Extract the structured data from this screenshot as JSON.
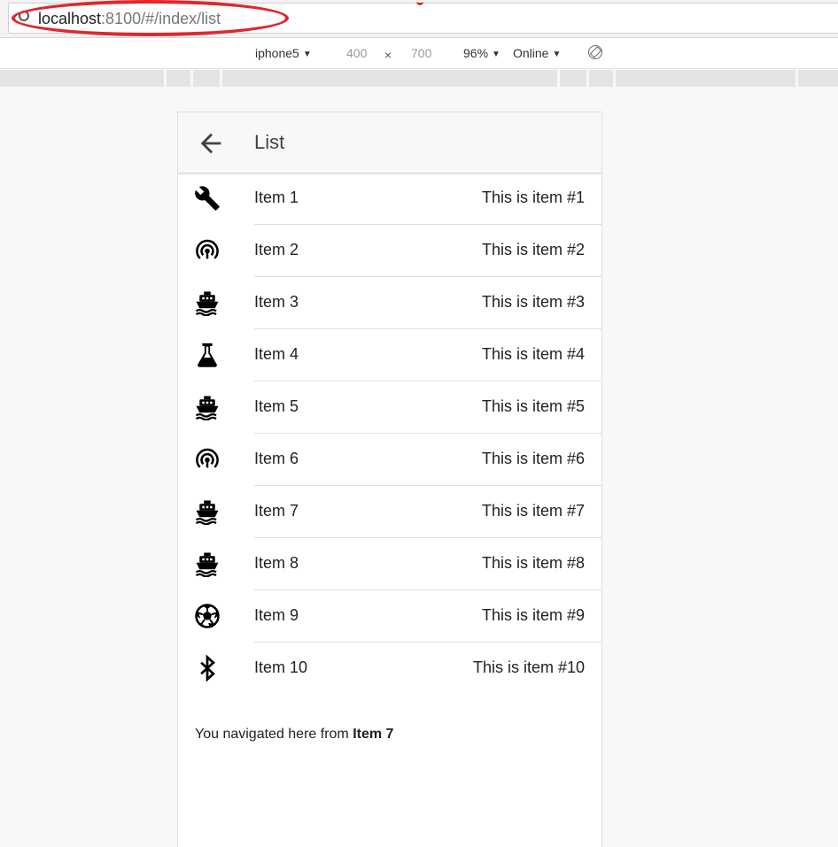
{
  "browser": {
    "url_host": "localhost",
    "url_rest": ":8100/#/index/list"
  },
  "device_toolbar": {
    "device": "iphone5",
    "width": "400",
    "times": "×",
    "height": "700",
    "zoom": "96%",
    "network": "Online",
    "dropdown_caret": "▼"
  },
  "app": {
    "title": "List",
    "back_icon": "arrow-back-icon",
    "items": [
      {
        "label": "Item 1",
        "note": "This is item #1",
        "icon": "wrench-icon"
      },
      {
        "label": "Item 2",
        "note": "This is item #2",
        "icon": "wifi-broadcast-icon"
      },
      {
        "label": "Item 3",
        "note": "This is item #3",
        "icon": "ship-icon"
      },
      {
        "label": "Item 4",
        "note": "This is item #4",
        "icon": "flask-icon"
      },
      {
        "label": "Item 5",
        "note": "This is item #5",
        "icon": "ship-icon"
      },
      {
        "label": "Item 6",
        "note": "This is item #6",
        "icon": "wifi-broadcast-icon"
      },
      {
        "label": "Item 7",
        "note": "This is item #7",
        "icon": "ship-icon"
      },
      {
        "label": "Item 8",
        "note": "This is item #8",
        "icon": "ship-icon"
      },
      {
        "label": "Item 9",
        "note": "This is item #9",
        "icon": "football-icon"
      },
      {
        "label": "Item 10",
        "note": "This is item #10",
        "icon": "bluetooth-icon"
      }
    ],
    "nav_message_prefix": "You navigated here from ",
    "nav_message_item": "Item 7"
  },
  "colors": {
    "annotation": "#e0262d",
    "toolbar_bg": "#f8f8f8",
    "text": "#222222"
  }
}
